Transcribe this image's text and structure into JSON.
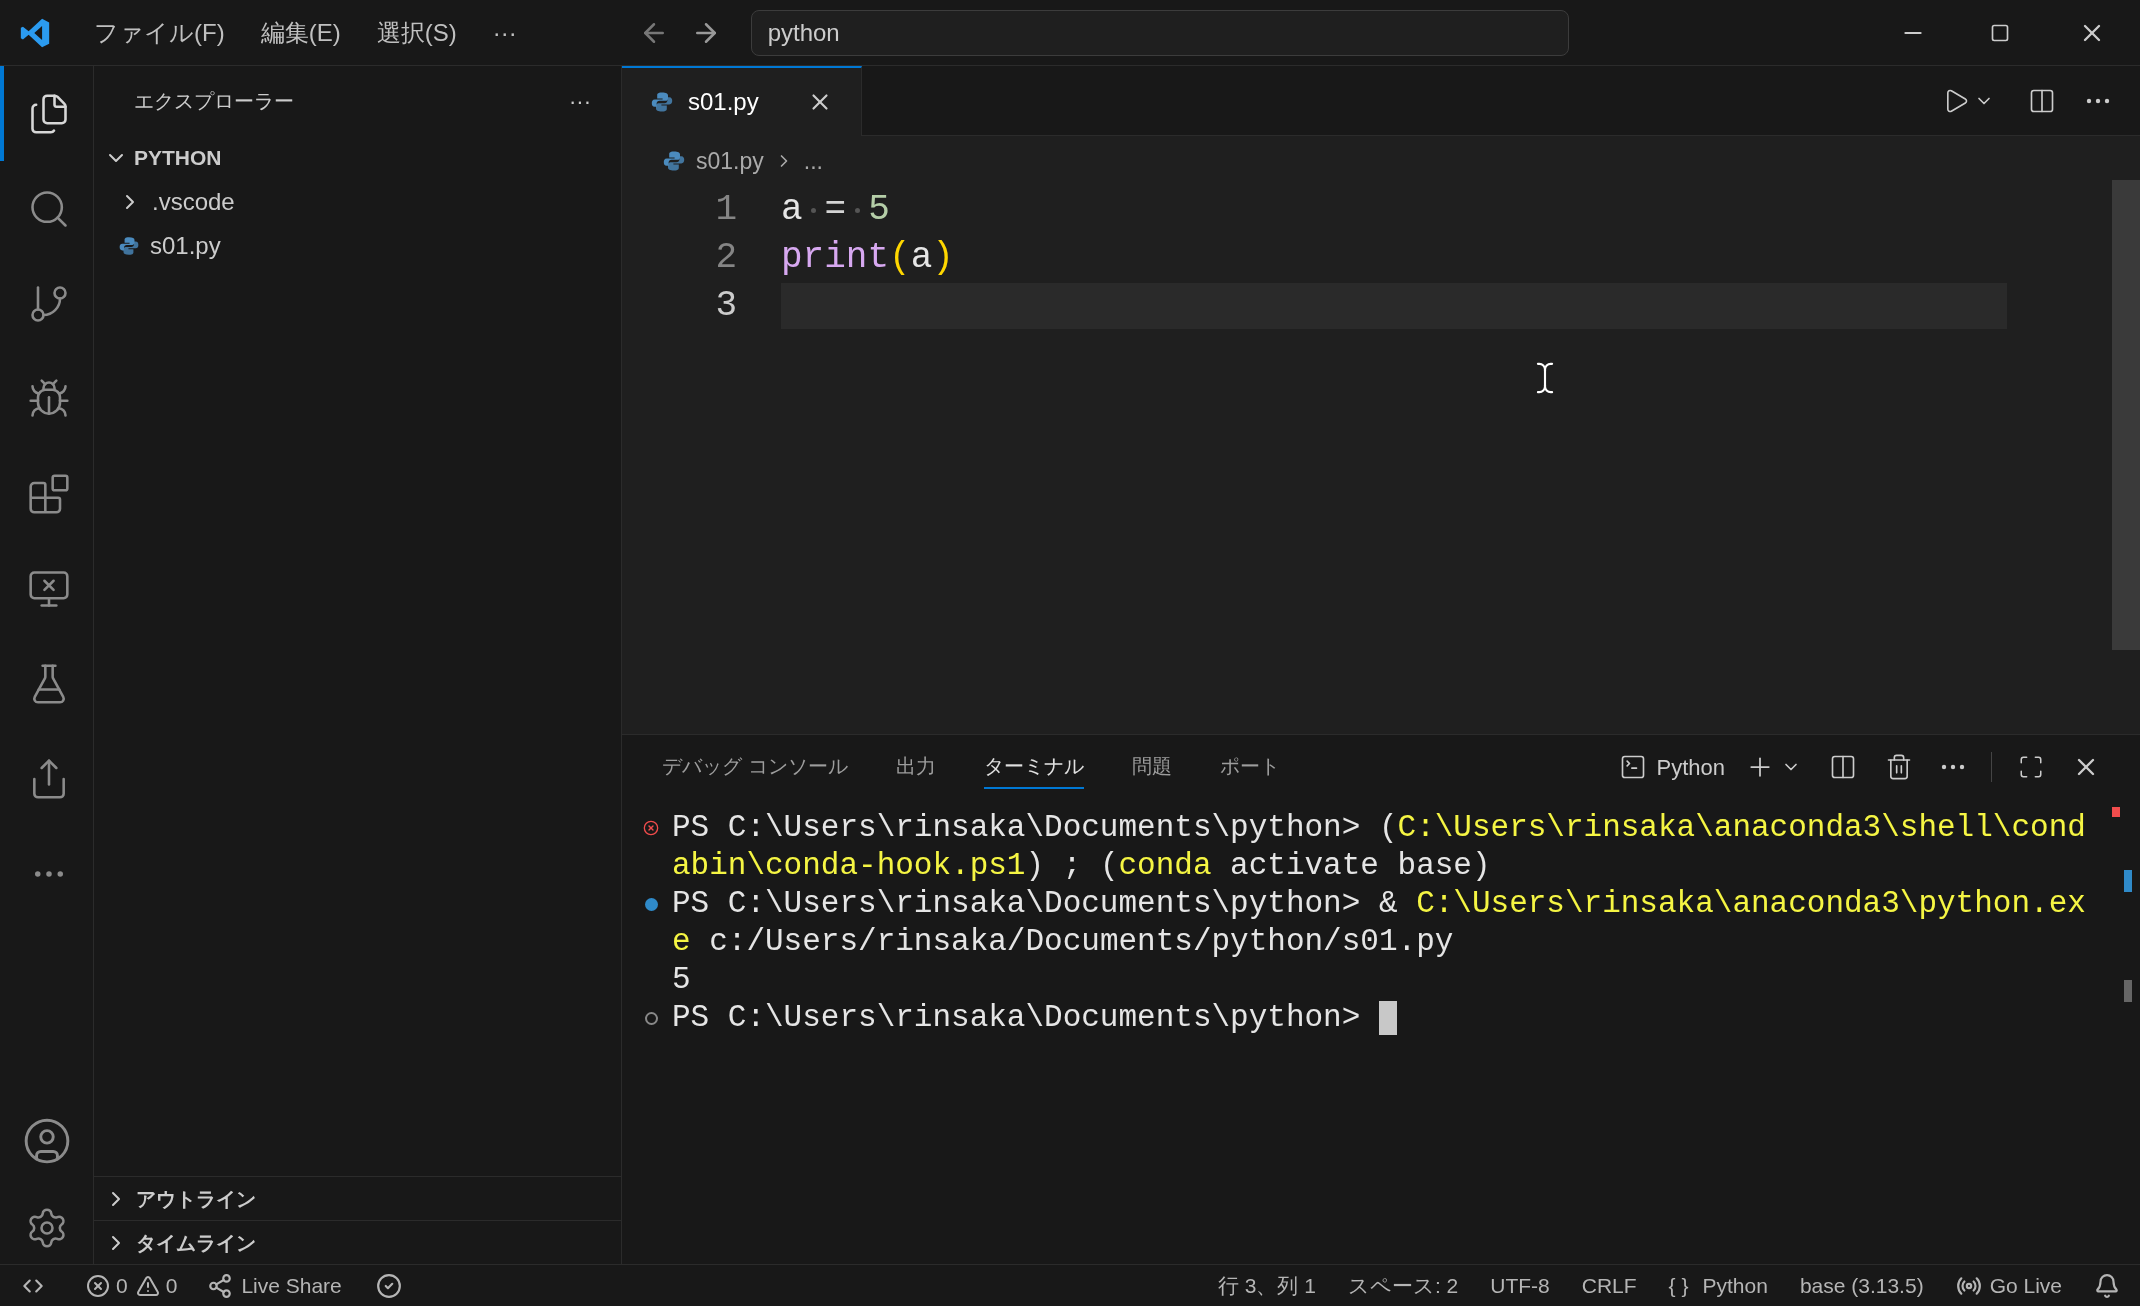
{
  "title_bar": {
    "menus": [
      "ファイル(F)",
      "編集(E)",
      "選択(S)",
      "···"
    ],
    "search": {
      "value": "python"
    }
  },
  "activity_bar": [
    {
      "selected": true
    },
    {
      "selected": false
    },
    {
      "selected": false
    },
    {
      "selected": false
    },
    {
      "selected": false
    },
    {
      "selected": false
    },
    {
      "selected": false
    },
    {
      "selected": false
    },
    {
      "selected": false
    }
  ],
  "sidebar": {
    "title": "エクスプローラー",
    "more": "···",
    "tree": [
      {
        "label": "PYTHON",
        "expanded": true,
        "children": [
          {
            "label": ".vscode",
            "kind": "folder",
            "expanded": false
          },
          {
            "label": "s01.py",
            "kind": "python"
          }
        ]
      }
    ],
    "sections": [
      {
        "label": "アウトライン",
        "expanded": false
      },
      {
        "label": "タイムライン",
        "expanded": false
      }
    ]
  },
  "editor": {
    "tabs": [
      {
        "label": "s01.py",
        "selected": true
      }
    ],
    "breadcrumb": [
      "s01.py",
      "..."
    ],
    "lines": [
      {
        "number": "1",
        "current": false,
        "tokens": [
          {
            "kind": "variable",
            "text": "a"
          },
          {
            "kind": "space"
          },
          {
            "kind": "operator",
            "text": "="
          },
          {
            "kind": "space"
          },
          {
            "kind": "number",
            "text": "5"
          }
        ]
      },
      {
        "number": "2",
        "current": false,
        "tokens": [
          {
            "kind": "function",
            "text": "print"
          },
          {
            "kind": "bracket",
            "text": "("
          },
          {
            "kind": "variable",
            "text": "a"
          },
          {
            "kind": "bracket",
            "text": ")"
          }
        ]
      },
      {
        "number": "3",
        "current": true
      }
    ]
  },
  "panel": {
    "tabs": [
      {
        "label": "デバッグ コンソール",
        "selected": false
      },
      {
        "label": "出力",
        "selected": false
      },
      {
        "label": "ターミナル",
        "selected": true
      },
      {
        "label": "問題",
        "selected": false
      },
      {
        "label": "ポート",
        "selected": false
      }
    ],
    "terminal_name": "Python",
    "lines": [
      {
        "kind": "error",
        "segments": [
          {
            "kind": "plain",
            "text": "PS C:\\Users\\rinsaka\\Documents\\python> ("
          },
          {
            "kind": "highlight",
            "text": "C:\\Users\\rinsaka\\anaconda3\\shell\\cond"
          }
        ]
      },
      {
        "kind": "continued",
        "segments": [
          {
            "kind": "highlight",
            "text": "abin\\conda-hook.ps1"
          },
          {
            "kind": "plain",
            "text": ") ; ("
          },
          {
            "kind": "highlight",
            "text": "conda"
          },
          {
            "kind": "plain",
            "text": " activate base)"
          }
        ]
      },
      {
        "kind": "success",
        "segments": [
          {
            "kind": "plain",
            "text": "PS C:\\Users\\rinsaka\\Documents\\python> & "
          },
          {
            "kind": "highlight",
            "text": "C:\\Users\\rinsaka\\anaconda3\\python.ex"
          }
        ]
      },
      {
        "kind": "continued",
        "segments": [
          {
            "kind": "highlight",
            "text": "e"
          },
          {
            "kind": "plain",
            "text": " c:/Users/rinsaka/Documents/python/s01.py"
          }
        ]
      },
      {
        "kind": "continued",
        "segments": [
          {
            "kind": "plain",
            "text": "5"
          }
        ]
      },
      {
        "kind": "idle",
        "cursor": true,
        "segments": [
          {
            "kind": "plain",
            "text": "PS C:\\Users\\rinsaka\\Documents\\python> "
          }
        ]
      }
    ]
  },
  "status_bar": {
    "errors": "0",
    "warnings": "0",
    "live_share": "Live Share",
    "right": [
      {
        "kind": "text",
        "text": "行 3、列 1"
      },
      {
        "kind": "text",
        "text": "スペース: 2"
      },
      {
        "kind": "text",
        "text": "UTF-8"
      },
      {
        "kind": "text",
        "text": "CRLF"
      },
      {
        "kind": "braces",
        "icon_text": "{ }",
        "text": "Python"
      },
      {
        "kind": "text",
        "text": "base (3.13.5)"
      },
      {
        "kind": "golive",
        "text": "Go Live"
      }
    ]
  }
}
